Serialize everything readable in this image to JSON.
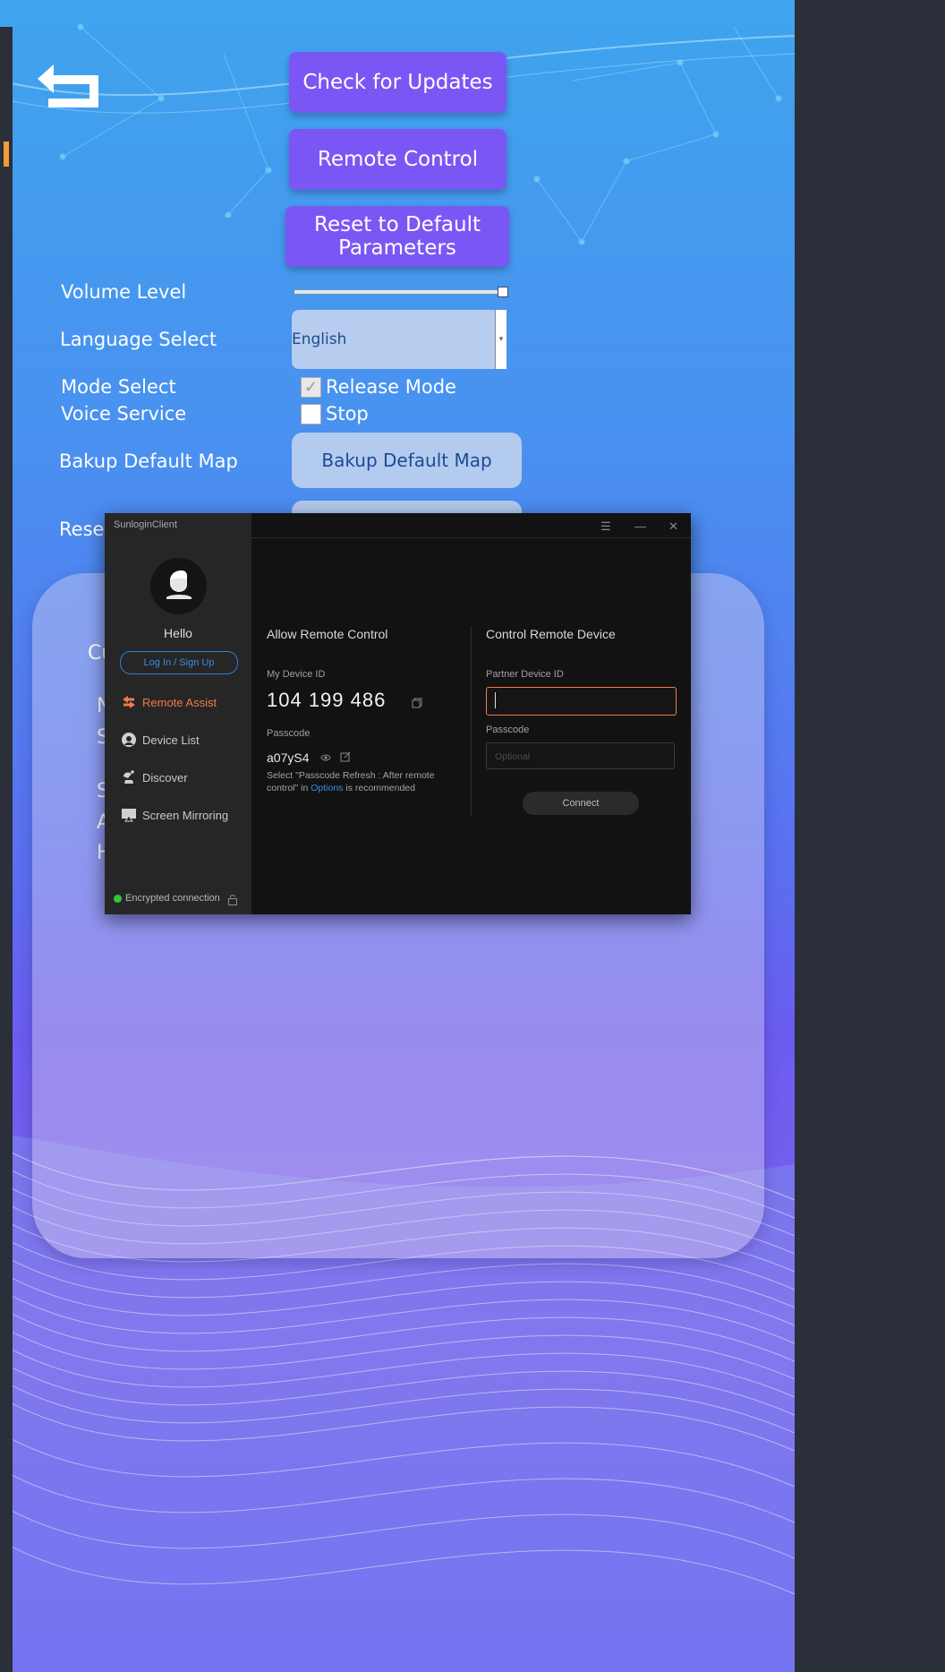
{
  "settings": {
    "buttons": {
      "check_updates": "Check for Updates",
      "remote_control": "Remote Control",
      "reset_defaults": "Reset to Default Parameters"
    },
    "volume": {
      "label": "Volume Level",
      "level": 1.0
    },
    "language": {
      "label": "Language Select",
      "value": "English"
    },
    "mode": {
      "label": "Mode Select",
      "option": "Release Mode",
      "checked": true
    },
    "voice": {
      "label": "Voice Service",
      "option": "Stop",
      "checked": false
    },
    "backup_map": {
      "label": "Bakup Default Map",
      "button": "Bakup Default Map"
    },
    "reset_row": {
      "label_partial": "Reset"
    },
    "card_letters": [
      "Cu",
      "N",
      "S",
      "S",
      "A",
      "H"
    ]
  },
  "sunlogin": {
    "window_title": "SunloginClient",
    "greeting": "Hello",
    "login_label": "Log In / Sign Up",
    "nav": [
      {
        "label": "Remote Assist",
        "icon": "remote-assist-icon",
        "active": true
      },
      {
        "label": "Device List",
        "icon": "device-list-icon",
        "active": false
      },
      {
        "label": "Discover",
        "icon": "discover-icon",
        "active": false
      },
      {
        "label": "Screen Mirroring",
        "icon": "screen-mirroring-icon",
        "active": false
      }
    ],
    "encrypted": "Encrypted connection",
    "allow": {
      "title": "Allow Remote Control",
      "device_id_label": "My Device ID",
      "device_id": "104 199 486",
      "passcode_label": "Passcode",
      "passcode": "a07yS4",
      "hint_before": "Select \"Passcode Refresh : After remote control\" in ",
      "hint_link": "Options",
      "hint_after": " is recommended"
    },
    "control": {
      "title": "Control Remote Device",
      "partner_label": "Partner Device ID",
      "partner_value": "",
      "passcode_label": "Passcode",
      "passcode_placeholder": "Optional",
      "connect_label": "Connect"
    },
    "colors": {
      "accent": "#f07b4b",
      "link": "#3b8de0",
      "ok": "#33c53a"
    }
  }
}
